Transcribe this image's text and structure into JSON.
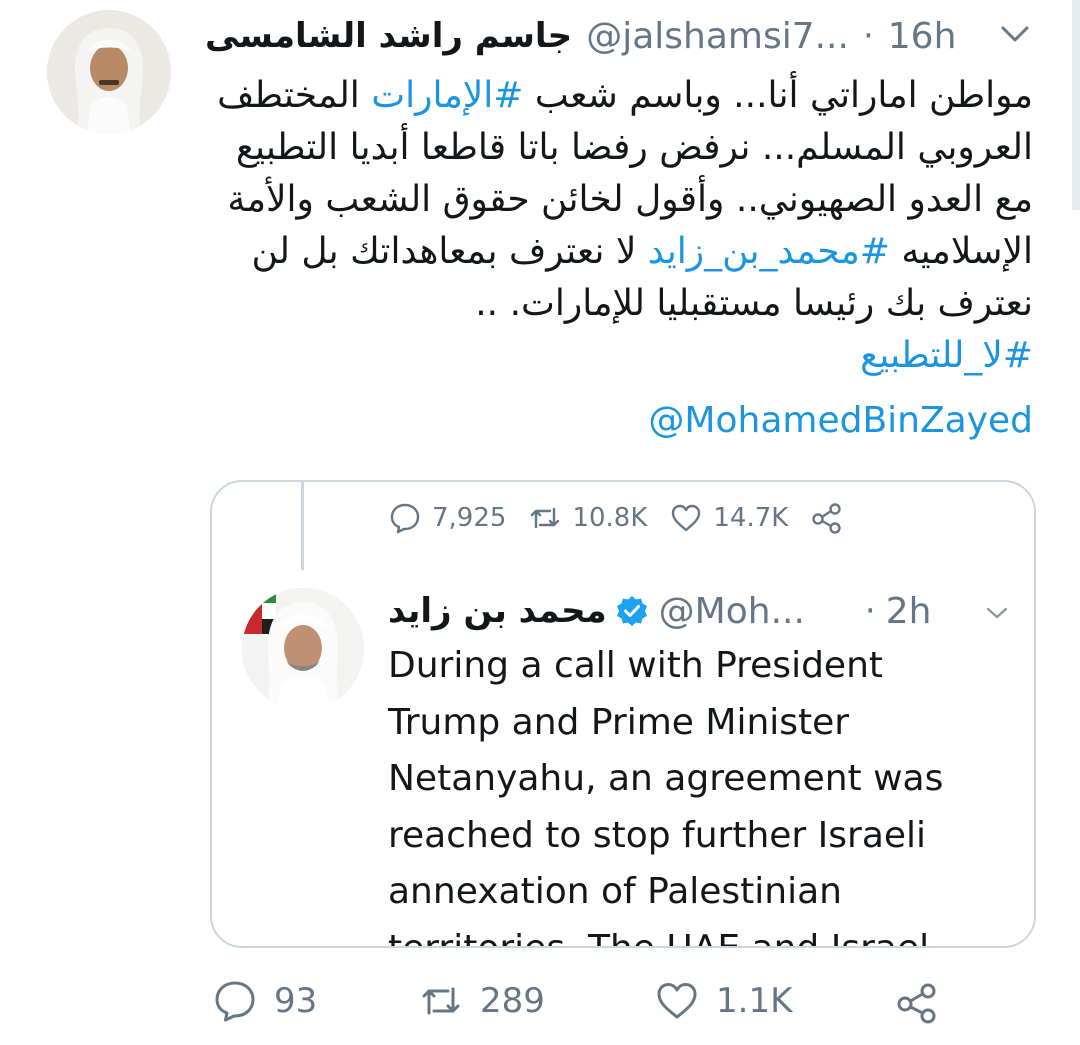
{
  "tweet": {
    "display_name": "جاسم راشد الشامسى",
    "handle": "@jalshamsi7...",
    "dot": "·",
    "time": "16h",
    "text_lines": [
      [
        {
          "t": "مواطن اماراتي أنا... وباسم شعب ",
          "tag": false
        },
        {
          "t": "#الإمارات",
          "tag": true
        },
        {
          "t": " المختطف",
          "tag": false
        }
      ],
      [
        {
          "t": "العروبي المسلم... نرفض رفضا باتا قاطعا أبديا التطبيع",
          "tag": false
        }
      ],
      [
        {
          "t": "مع العدو الصهيوني.. وأقول لخائن حقوق الشعب والأمة",
          "tag": false
        }
      ],
      [
        {
          "t": "الإسلاميه ",
          "tag": false
        },
        {
          "t": "#محمد_بن_زايد",
          "tag": true
        },
        {
          "t": "  لا نعترف بمعاهداتك بل لن",
          "tag": false
        }
      ],
      [
        {
          "t": "نعترف بك رئيسا مستقبليا للإمارات. ..",
          "tag": false
        }
      ],
      [
        {
          "t": "#لا_للتطبيع",
          "tag": true
        }
      ]
    ],
    "mention": "@MohamedBinZayed",
    "actions": {
      "replies": "93",
      "retweets": "289",
      "likes": "1.1K"
    }
  },
  "quoted": {
    "actions": {
      "replies": "7,925",
      "retweets": "10.8K",
      "likes": "14.7K"
    },
    "display_name": "محمد بن زايد",
    "handle": "@Moh...",
    "dot": "·",
    "time": "2h",
    "text_lines": [
      "During a call with President",
      "Trump and Prime Minister",
      "Netanyahu, an agreement was",
      "reached to stop further Israeli",
      "annexation of Palestinian",
      "territories. The UAE and Israel"
    ]
  },
  "icons": {
    "reply": "speech-bubble-icon",
    "retweet": "retweet-arrows-icon",
    "like": "heart-icon",
    "share": "share-icon",
    "verified": "verified-badge-icon",
    "caret": "chevron-down-icon"
  },
  "colors": {
    "link": "#1b95e0",
    "muted": "#657786",
    "border": "#ccd6dd",
    "verified": "#1da1f2"
  }
}
